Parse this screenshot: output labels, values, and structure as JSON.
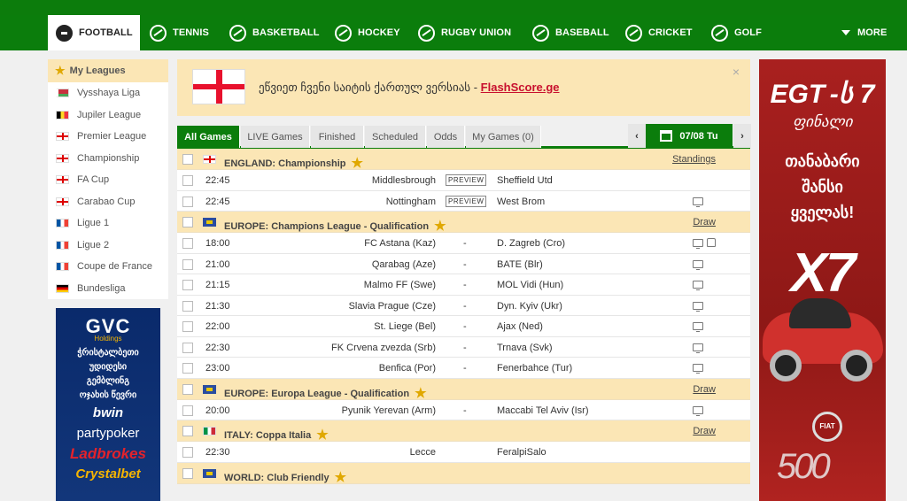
{
  "sport_nav": {
    "items": [
      {
        "label": "Football",
        "icon": "football-icon",
        "active": true
      },
      {
        "label": "Tennis",
        "icon": "tennis-icon"
      },
      {
        "label": "Basketball",
        "icon": "basketball-icon"
      },
      {
        "label": "Hockey",
        "icon": "hockey-icon"
      },
      {
        "label": "Rugby Union",
        "icon": "rugby-icon"
      },
      {
        "label": "Baseball",
        "icon": "baseball-icon"
      },
      {
        "label": "Cricket",
        "icon": "cricket-icon"
      },
      {
        "label": "Golf",
        "icon": "golf-icon"
      }
    ],
    "more_label": "MORE"
  },
  "my_leagues": {
    "title": "My Leagues",
    "items": [
      {
        "label": "Vysshaya Liga",
        "flag": "BY"
      },
      {
        "label": "Jupiler League",
        "flag": "BE"
      },
      {
        "label": "Premier League",
        "flag": "EN"
      },
      {
        "label": "Championship",
        "flag": "EN"
      },
      {
        "label": "FA Cup",
        "flag": "EN"
      },
      {
        "label": "Carabao Cup",
        "flag": "EN"
      },
      {
        "label": "Ligue 1",
        "flag": "FR"
      },
      {
        "label": "Ligue 2",
        "flag": "FR"
      },
      {
        "label": "Coupe de France",
        "flag": "FR"
      },
      {
        "label": "Bundesliga",
        "flag": "DE"
      }
    ]
  },
  "left_ad": {
    "logo": "GVC",
    "logo_sub": "Holdings",
    "lines": [
      "ჭრისტალბეთი",
      "უდიდესი",
      "გემბლინგ",
      "ოჯახის წევრი"
    ],
    "brands": [
      "bwin",
      "partypoker",
      "Ladbrokes",
      "Crystalbet"
    ]
  },
  "notice": {
    "text": "ეწვიეთ ჩვენი საიტის ქართულ ვერსიას - ",
    "link": "FlashScore.ge",
    "close": "×"
  },
  "tabs": {
    "items": [
      "All Games",
      "LIVE Games",
      "Finished",
      "Scheduled",
      "Odds",
      "My Games (0)"
    ],
    "active": "All Games",
    "prev": "‹",
    "next": "›",
    "date": "07/08 Tu"
  },
  "sections": [
    {
      "country": "ENGLAND",
      "competition": "Championship",
      "flag": "EN",
      "link": "Standings",
      "matches": [
        {
          "time": "22:45",
          "home": "Middlesbrough",
          "away": "Sheffield Utd",
          "preview": "PREVIEW",
          "tv": false
        },
        {
          "time": "22:45",
          "home": "Nottingham",
          "away": "West Brom",
          "preview": "PREVIEW",
          "tv": true
        }
      ]
    },
    {
      "country": "EUROPE",
      "competition": "Champions League - Qualification",
      "flag": "EU",
      "link": "Draw",
      "matches": [
        {
          "time": "18:00",
          "home": "FC Astana (Kaz)",
          "away": "D. Zagreb (Cro)",
          "tv": true,
          "shirt": true
        },
        {
          "time": "21:00",
          "home": "Qarabag (Aze)",
          "away": "BATE (Blr)",
          "tv": true
        },
        {
          "time": "21:15",
          "home": "Malmo FF (Swe)",
          "away": "MOL Vidi (Hun)",
          "tv": true
        },
        {
          "time": "21:30",
          "home": "Slavia Prague (Cze)",
          "away": "Dyn. Kyiv (Ukr)",
          "tv": true
        },
        {
          "time": "22:00",
          "home": "St. Liege (Bel)",
          "away": "Ajax (Ned)",
          "tv": true
        },
        {
          "time": "22:30",
          "home": "FK Crvena zvezda (Srb)",
          "away": "Trnava (Svk)",
          "tv": true
        },
        {
          "time": "23:00",
          "home": "Benfica (Por)",
          "away": "Fenerbahce (Tur)",
          "tv": true
        }
      ]
    },
    {
      "country": "EUROPE",
      "competition": "Europa League - Qualification",
      "flag": "EU",
      "link": "Draw",
      "matches": [
        {
          "time": "20:00",
          "home": "Pyunik Yerevan (Arm)",
          "away": "Maccabi Tel Aviv (Isr)",
          "tv": true
        }
      ]
    },
    {
      "country": "ITALY",
      "competition": "Coppa Italia",
      "flag": "IT",
      "link": "Draw",
      "matches": [
        {
          "time": "22:30",
          "home": "Lecce",
          "away": "FeralpiSalo",
          "tv": false
        }
      ]
    },
    {
      "country": "WORLD",
      "competition": "Club Friendly",
      "flag": "EU",
      "link": "",
      "matches": []
    }
  ],
  "right_ad": {
    "logo": "EGT",
    "logo_suffix": "-ს 7",
    "final": "ფინალი",
    "slogan": [
      "თანაბარი",
      "შანსი",
      "ყველას!"
    ],
    "multiplier": "X7",
    "car_brand": "FIAT",
    "car_model": "500"
  },
  "colors": {
    "brand_green": "#0b7d0c",
    "league_bg": "#fbe6b5",
    "link_red": "#c8102e",
    "star": "#e0a800"
  }
}
